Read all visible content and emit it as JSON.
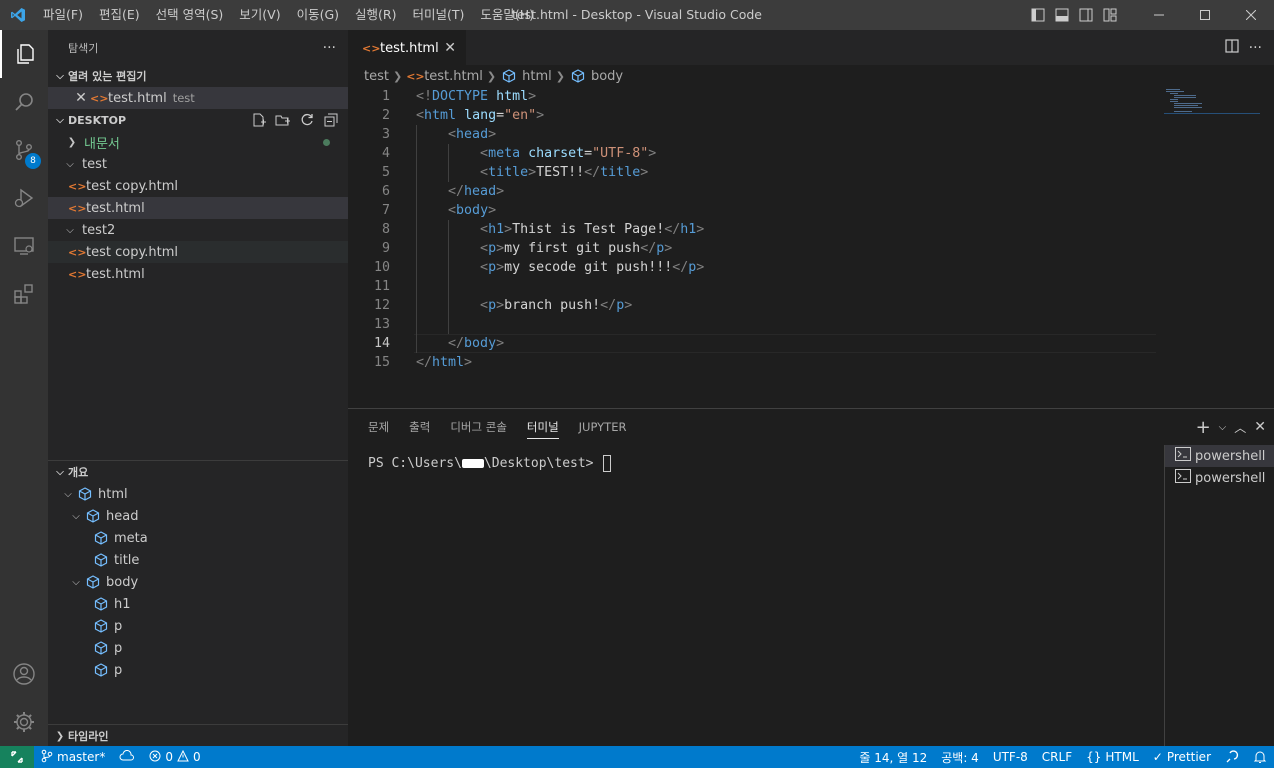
{
  "window": {
    "title": "test.html - Desktop - Visual Studio Code",
    "menu": [
      "파일(F)",
      "편집(E)",
      "선택 영역(S)",
      "보기(V)",
      "이동(G)",
      "실행(R)",
      "터미널(T)",
      "도움말(H)"
    ]
  },
  "activity": {
    "scm_badge": "8"
  },
  "sidebar": {
    "title": "탐색기",
    "more": "···",
    "open_editors": {
      "label": "열려 있는 편집기",
      "file_name": "test.html",
      "file_desc": "test"
    },
    "workspace": {
      "label": "DESKTOP",
      "items": [
        {
          "label": "내문서"
        },
        {
          "label": "test"
        },
        {
          "label": "test copy.html"
        },
        {
          "label": "test.html"
        },
        {
          "label": "test2"
        },
        {
          "label": "test copy.html"
        },
        {
          "label": "test.html"
        }
      ]
    },
    "outline": {
      "label": "개요",
      "items": [
        "html",
        "head",
        "meta",
        "title",
        "body",
        "h1",
        "p",
        "p",
        "p"
      ]
    },
    "timeline": {
      "label": "타임라인"
    }
  },
  "editor": {
    "tab": "test.html",
    "breadcrumb": [
      "test",
      "test.html",
      "html",
      "body"
    ],
    "lines": [
      {
        "n": "1",
        "html": "<span class=\"br\">&lt;!</span><span class=\"tag\">DOCTYPE</span> <span class=\"attr\">html</span><span class=\"br\">&gt;</span>"
      },
      {
        "n": "2",
        "html": "<span class=\"br\">&lt;</span><span class=\"tag\">html</span> <span class=\"attr\">lang</span><span class=\"plain\">=</span><span class=\"str\">\"en\"</span><span class=\"br\">&gt;</span>"
      },
      {
        "n": "3",
        "html": "    <span class=\"br\">&lt;</span><span class=\"tag\">head</span><span class=\"br\">&gt;</span>"
      },
      {
        "n": "4",
        "html": "        <span class=\"br\">&lt;</span><span class=\"tag\">meta</span> <span class=\"attr\">charset</span><span class=\"plain\">=</span><span class=\"str\">\"UTF-8\"</span><span class=\"br\">&gt;</span>"
      },
      {
        "n": "5",
        "html": "        <span class=\"br\">&lt;</span><span class=\"tag\">title</span><span class=\"br\">&gt;</span><span class=\"plain\">TEST!!</span><span class=\"br\">&lt;/</span><span class=\"tag\">title</span><span class=\"br\">&gt;</span>"
      },
      {
        "n": "6",
        "html": "    <span class=\"br\">&lt;/</span><span class=\"tag\">head</span><span class=\"br\">&gt;</span>"
      },
      {
        "n": "7",
        "html": "    <span class=\"br\">&lt;</span><span class=\"tag\">body</span><span class=\"br\">&gt;</span>"
      },
      {
        "n": "8",
        "html": "        <span class=\"br\">&lt;</span><span class=\"tag\">h1</span><span class=\"br\">&gt;</span><span class=\"plain\">Thist is Test Page!</span><span class=\"br\">&lt;/</span><span class=\"tag\">h1</span><span class=\"br\">&gt;</span>"
      },
      {
        "n": "9",
        "html": "        <span class=\"br\">&lt;</span><span class=\"tag\">p</span><span class=\"br\">&gt;</span><span class=\"plain\">my first git push</span><span class=\"br\">&lt;/</span><span class=\"tag\">p</span><span class=\"br\">&gt;</span>"
      },
      {
        "n": "10",
        "html": "        <span class=\"br\">&lt;</span><span class=\"tag\">p</span><span class=\"br\">&gt;</span><span class=\"plain\">my secode git push!!!</span><span class=\"br\">&lt;/</span><span class=\"tag\">p</span><span class=\"br\">&gt;</span>"
      },
      {
        "n": "11",
        "html": ""
      },
      {
        "n": "12",
        "html": "        <span class=\"br\">&lt;</span><span class=\"tag\">p</span><span class=\"br\">&gt;</span><span class=\"plain\">branch push!</span><span class=\"br\">&lt;/</span><span class=\"tag\">p</span><span class=\"br\">&gt;</span>"
      },
      {
        "n": "13",
        "html": ""
      },
      {
        "n": "14",
        "html": "    <span class=\"br\">&lt;/</span><span class=\"tag\">body</span><span class=\"br\">&gt;</span>"
      },
      {
        "n": "15",
        "html": "<span class=\"br\">&lt;/</span><span class=\"tag\">html</span><span class=\"br\">&gt;</span>"
      }
    ],
    "current_line": "14"
  },
  "panel": {
    "tabs": [
      "문제",
      "출력",
      "디버그 콘솔",
      "터미널",
      "JUPYTER"
    ],
    "active_tab": "터미널",
    "prompt_prefix": "PS C:\\Users\\",
    "prompt_suffix": "\\Desktop\\test> ",
    "terminals": [
      "powershell",
      "powershell"
    ]
  },
  "status": {
    "branch": "master*",
    "errors": "0",
    "warnings": "0",
    "position": "줄 14, 열 12",
    "spaces": "공백: 4",
    "encoding": "UTF-8",
    "eol": "CRLF",
    "language": "HTML",
    "formatter": "Prettier"
  },
  "colors": {
    "accent": "#007acc",
    "remote": "#16825d",
    "html_icon": "#e37933",
    "outline_icon": "#75beff"
  }
}
